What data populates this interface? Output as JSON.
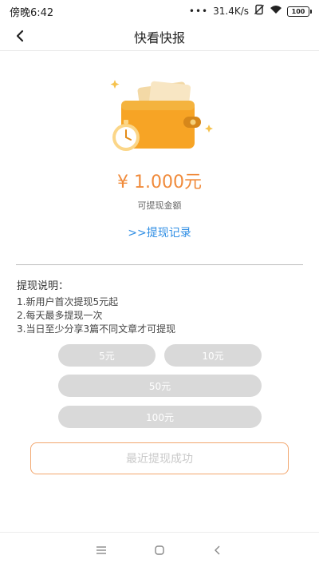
{
  "status_bar": {
    "time": "傍晚6:42",
    "dots": "•••",
    "speed": "31.4K/s",
    "battery": "100"
  },
  "header": {
    "title": "快看快报"
  },
  "balance": {
    "amount": "¥ 1.000元",
    "label": "可提现金额"
  },
  "history_link": ">>提现记录",
  "instructions": {
    "heading": "提现说明：",
    "lines": [
      "1.新用户首次提现5元起",
      "2.每天最多提现一次",
      "3.当日至少分享3篇不同文章才可提现"
    ]
  },
  "options": [
    "5元",
    "10元",
    "50元",
    "100元"
  ],
  "submit_label": "最近提现成功",
  "colors": {
    "accent": "#f08a3a",
    "link": "#2f8ee4",
    "wallet": "#f7a425",
    "option_bg": "#d9d9d9"
  }
}
